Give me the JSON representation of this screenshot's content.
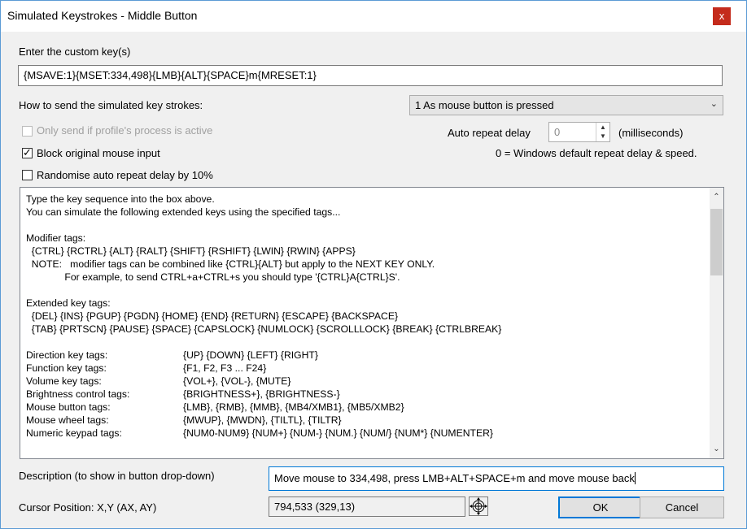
{
  "window": {
    "title": "Simulated Keystrokes - Middle Button",
    "close_glyph": "x"
  },
  "custom_keys": {
    "label": "Enter the custom key(s)",
    "value": "{MSAVE:1}{MSET:334,498}{LMB}{ALT}{SPACE}m{MRESET:1}"
  },
  "send_mode": {
    "label": "How to send the simulated key strokes:",
    "selected": "1 As mouse button is pressed"
  },
  "options": {
    "only_if_active": {
      "label": "Only send if profile's process is active",
      "checked": false,
      "enabled": false
    },
    "block_mouse": {
      "label": "Block original mouse input",
      "checked": true
    },
    "randomise": {
      "label": "Randomise auto repeat delay by 10%",
      "checked": false
    }
  },
  "repeat": {
    "label": "Auto repeat delay",
    "value": "0",
    "unit": "(milliseconds)",
    "hint": "0 = Windows default repeat delay & speed."
  },
  "help": {
    "lines": [
      "Type the key sequence into the box above.",
      "You can simulate the following extended keys using the specified tags...",
      "",
      "Modifier tags:",
      "  {CTRL} {RCTRL} {ALT} {RALT} {SHIFT} {RSHIFT} {LWIN} {RWIN} {APPS}",
      "  NOTE:   modifier tags can be combined like {CTRL}{ALT} but apply to the NEXT KEY ONLY.",
      "              For example, to send CTRL+a+CTRL+s you should type '{CTRL}A{CTRL}S'.",
      "",
      "Extended key tags:",
      "  {DEL} {INS} {PGUP} {PGDN} {HOME} {END} {RETURN} {ESCAPE} {BACKSPACE}",
      "  {TAB} {PRTSCN} {PAUSE} {SPACE} {CAPSLOCK} {NUMLOCK} {SCROLLLOCK} {BREAK} {CTRLBREAK}",
      ""
    ],
    "table": [
      {
        "name": "Direction key tags:",
        "tags": "{UP} {DOWN} {LEFT} {RIGHT}"
      },
      {
        "name": "Function key tags:",
        "tags": "{F1, F2, F3 ... F24}"
      },
      {
        "name": "Volume key tags:",
        "tags": "{VOL+}, {VOL-}, {MUTE}"
      },
      {
        "name": "Brightness control tags:",
        "tags": "{BRIGHTNESS+}, {BRIGHTNESS-}"
      },
      {
        "name": "Mouse button tags:",
        "tags": "{LMB}, {RMB}, {MMB}, {MB4/XMB1}, {MB5/XMB2}"
      },
      {
        "name": "Mouse wheel tags:",
        "tags": "{MWUP}, {MWDN}, {TILTL}, {TILTR}"
      },
      {
        "name": "Numeric keypad tags:",
        "tags": "{NUM0-NUM9} {NUM+} {NUM-} {NUM.} {NUM/} {NUM*} {NUMENTER}"
      }
    ]
  },
  "description": {
    "label": "Description (to show in button drop-down)",
    "value": "Move mouse to 334,498, press LMB+ALT+SPACE+m and move mouse back"
  },
  "cursor": {
    "label": "Cursor Position: X,Y (AX, AY)",
    "value": "794,533 (329,13)"
  },
  "buttons": {
    "ok": "OK",
    "cancel": "Cancel"
  },
  "icons": {
    "close": "close-icon",
    "dropdown": "chevron-down-icon",
    "check": "check-icon",
    "spin_up": "spin-up-icon",
    "spin_down": "spin-down-icon",
    "scroll_up": "scroll-up-icon",
    "scroll_down": "scroll-down-icon",
    "crosshair": "crosshair-icon"
  },
  "colors": {
    "close_button": "#c42b1c",
    "focus_border": "#0078d7"
  }
}
